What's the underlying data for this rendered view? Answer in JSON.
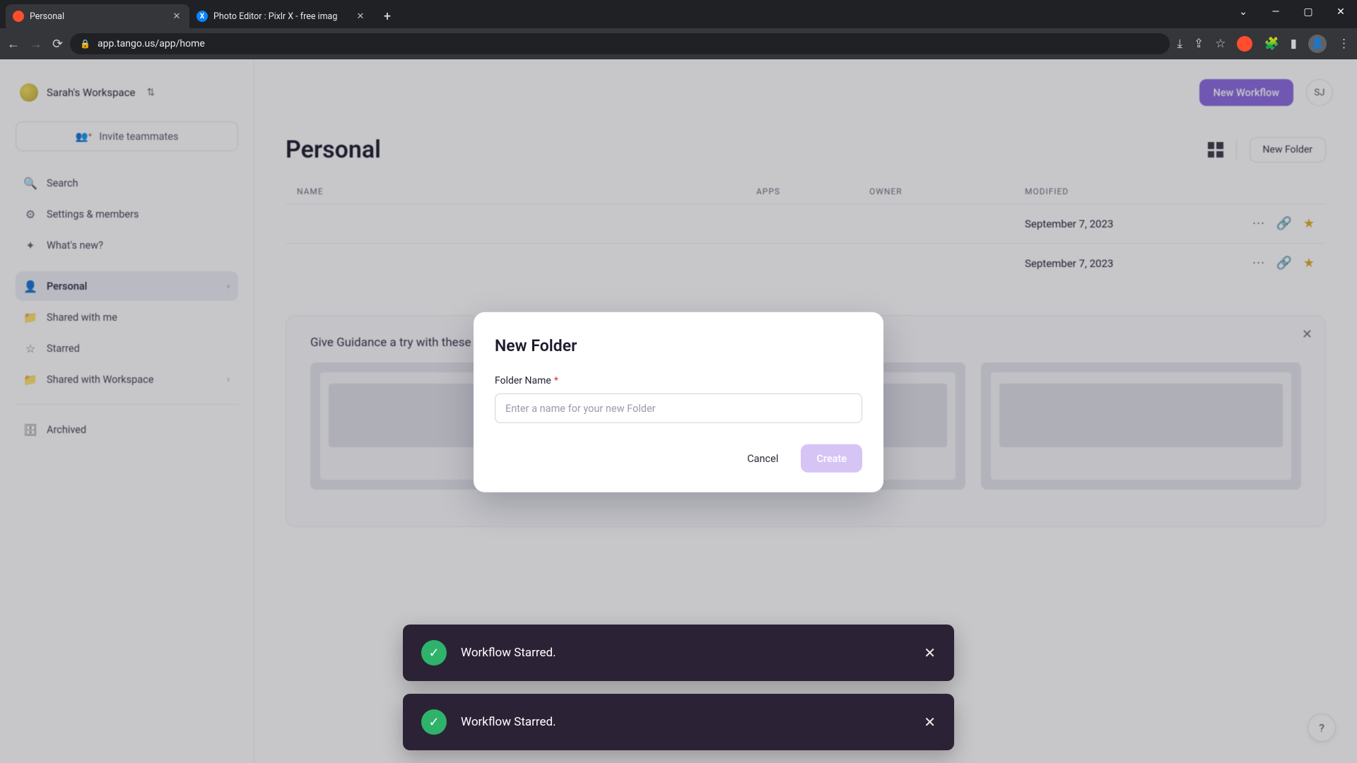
{
  "browser": {
    "tabs": [
      {
        "title": "Personal",
        "favicon": "tango",
        "active": true
      },
      {
        "title": "Photo Editor : Pixlr X - free imag",
        "favicon": "pixlr",
        "active": false
      }
    ],
    "url": "app.tango.us/app/home"
  },
  "sidebar": {
    "workspace_name": "Sarah's Workspace",
    "invite_label": "Invite teammates",
    "items": {
      "search": "Search",
      "settings": "Settings & members",
      "whats_new": "What's new?",
      "personal": "Personal",
      "shared_with_me": "Shared with me",
      "starred": "Starred",
      "shared_with_ws": "Shared with Workspace",
      "archived": "Archived"
    }
  },
  "topbar": {
    "new_workflow": "New Workflow",
    "user_initials": "SJ"
  },
  "page": {
    "title": "Personal",
    "new_folder_btn": "New Folder"
  },
  "table": {
    "headers": {
      "name": "NAME",
      "apps": "APPS",
      "owner": "OWNER",
      "modified": "MODIFIED"
    },
    "rows": [
      {
        "modified": "September 7, 2023"
      },
      {
        "modified": "September 7, 2023"
      }
    ]
  },
  "guidance_title": "Give Guidance a try with these Tangos",
  "modal": {
    "title": "New Folder",
    "field_label": "Folder Name",
    "placeholder": "Enter a name for your new Folder",
    "cancel": "Cancel",
    "create": "Create"
  },
  "toasts": [
    {
      "msg": "Workflow Starred."
    },
    {
      "msg": "Workflow Starred."
    }
  ],
  "help_label": "?"
}
